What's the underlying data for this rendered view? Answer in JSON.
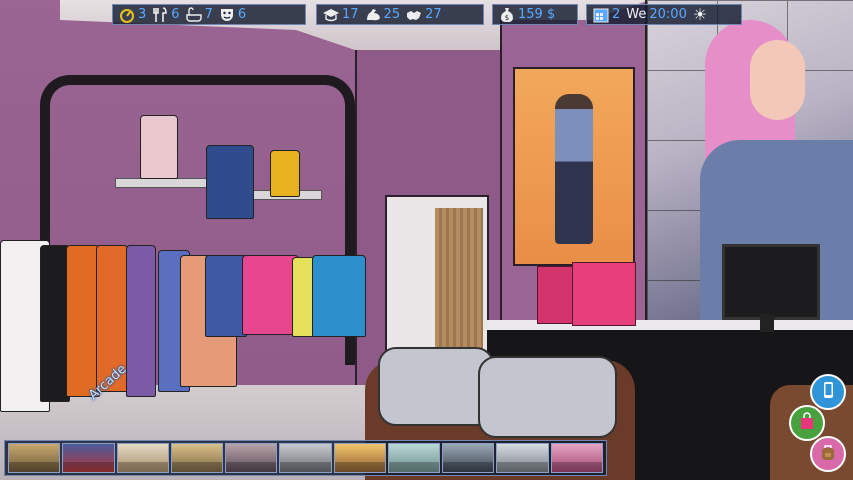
{
  "hud": {
    "needs": [
      {
        "icon": "energy-gauge-icon",
        "value": "3"
      },
      {
        "icon": "fork-knife-icon",
        "value": "6"
      },
      {
        "icon": "bathtub-icon",
        "value": "7"
      },
      {
        "icon": "theater-mask-icon",
        "value": "6"
      }
    ],
    "skills": [
      {
        "icon": "graduation-cap-icon",
        "value": "17"
      },
      {
        "icon": "strength-arm-icon",
        "value": "25"
      },
      {
        "icon": "handshake-icon",
        "value": "27"
      }
    ],
    "money": {
      "icon": "money-bag-icon",
      "value": "159 $"
    },
    "time": {
      "icon": "calendar-icon",
      "day_number": "2",
      "weekday": "We",
      "clock": "20:00",
      "weather_icon": "sun-icon"
    }
  },
  "location_label": "Arcade",
  "location_bar": {
    "thumbnails": [
      {
        "color_top": "#c7a76f",
        "color_bottom": "#6e5a3b"
      },
      {
        "color_top": "#4a5a9b",
        "color_bottom": "#b23a3a"
      },
      {
        "color_top": "#e4d9c4",
        "color_bottom": "#a58e6c"
      },
      {
        "color_top": "#d9c08a",
        "color_bottom": "#7d6845"
      },
      {
        "color_top": "#b9a3a9",
        "color_bottom": "#5a4c56"
      },
      {
        "color_top": "#c7c9cc",
        "color_bottom": "#6b6f75"
      },
      {
        "color_top": "#f2c46c",
        "color_bottom": "#8f6232"
      },
      {
        "color_top": "#b8d7d5",
        "color_bottom": "#6f8f8d"
      },
      {
        "color_top": "#9aa7b4",
        "color_bottom": "#3e4652"
      },
      {
        "color_top": "#d6dbe0",
        "color_bottom": "#7a8088"
      },
      {
        "color_top": "#e5a4c3",
        "color_bottom": "#a24a72"
      }
    ]
  },
  "side_buttons": [
    {
      "icon": "smartphone-icon",
      "bg": "#2f94d8"
    },
    {
      "icon": "shopping-bag-icon",
      "bg": "#47a23e"
    },
    {
      "icon": "backpack-icon",
      "bg": "#d96aa9"
    }
  ]
}
